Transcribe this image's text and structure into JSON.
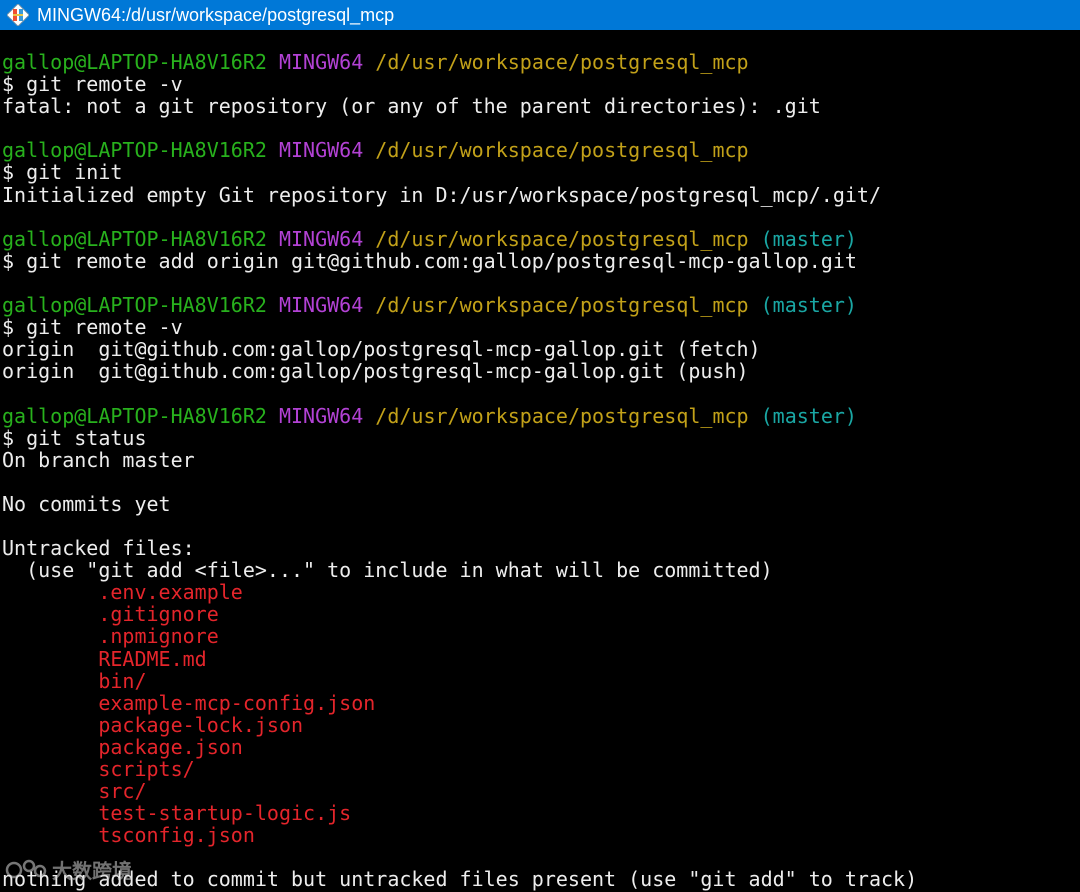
{
  "window": {
    "title": "MINGW64:/d/usr/workspace/postgresql_mcp",
    "icon": "git-bash-icon",
    "background": "#000000"
  },
  "colors": {
    "user": "#28b11d",
    "host": "#b342d5",
    "path": "#c2a119",
    "branch": "#1aa7a4",
    "untracked": "#e4252b",
    "text": "#ededed",
    "titlebar": "#0078d7"
  },
  "prompts": [
    {
      "user": "gallop@LAPTOP-HA8V16R2",
      "host": "MINGW64",
      "path": "/d/usr/workspace/postgresql_mcp",
      "branch": ""
    },
    {
      "user": "gallop@LAPTOP-HA8V16R2",
      "host": "MINGW64",
      "path": "/d/usr/workspace/postgresql_mcp",
      "branch": ""
    },
    {
      "user": "gallop@LAPTOP-HA8V16R2",
      "host": "MINGW64",
      "path": "/d/usr/workspace/postgresql_mcp",
      "branch": "(master)"
    },
    {
      "user": "gallop@LAPTOP-HA8V16R2",
      "host": "MINGW64",
      "path": "/d/usr/workspace/postgresql_mcp",
      "branch": "(master)"
    },
    {
      "user": "gallop@LAPTOP-HA8V16R2",
      "host": "MINGW64",
      "path": "/d/usr/workspace/postgresql_mcp",
      "branch": "(master)"
    }
  ],
  "commands": [
    "$ git remote -v",
    "$ git init",
    "$ git remote add origin git@github.com:gallop/postgresql-mcp-gallop.git",
    "$ git remote -v",
    "$ git status"
  ],
  "outputs": {
    "fatal": "fatal: not a git repository (or any of the parent directories): .git",
    "init": "Initialized empty Git repository in D:/usr/workspace/postgresql_mcp/.git/",
    "remote_fetch": "origin  git@github.com:gallop/postgresql-mcp-gallop.git (fetch)",
    "remote_push": "origin  git@github.com:gallop/postgresql-mcp-gallop.git (push)",
    "on_branch": "On branch master",
    "no_commits": "No commits yet",
    "untracked_header": "Untracked files:",
    "untracked_hint": "  (use \"git add <file>...\" to include in what will be committed)",
    "nothing_added": "nothing added to commit but untracked files present (use \"git add\" to track)"
  },
  "untracked_files": [
    ".env.example",
    ".gitignore",
    ".npmignore",
    "README.md",
    "bin/",
    "example-mcp-config.json",
    "package-lock.json",
    "package.json",
    "scripts/",
    "src/",
    "test-startup-logic.js",
    "tsconfig.json"
  ],
  "watermark": {
    "text": "大数跨境",
    "icon": "watermark-logo-icon"
  }
}
